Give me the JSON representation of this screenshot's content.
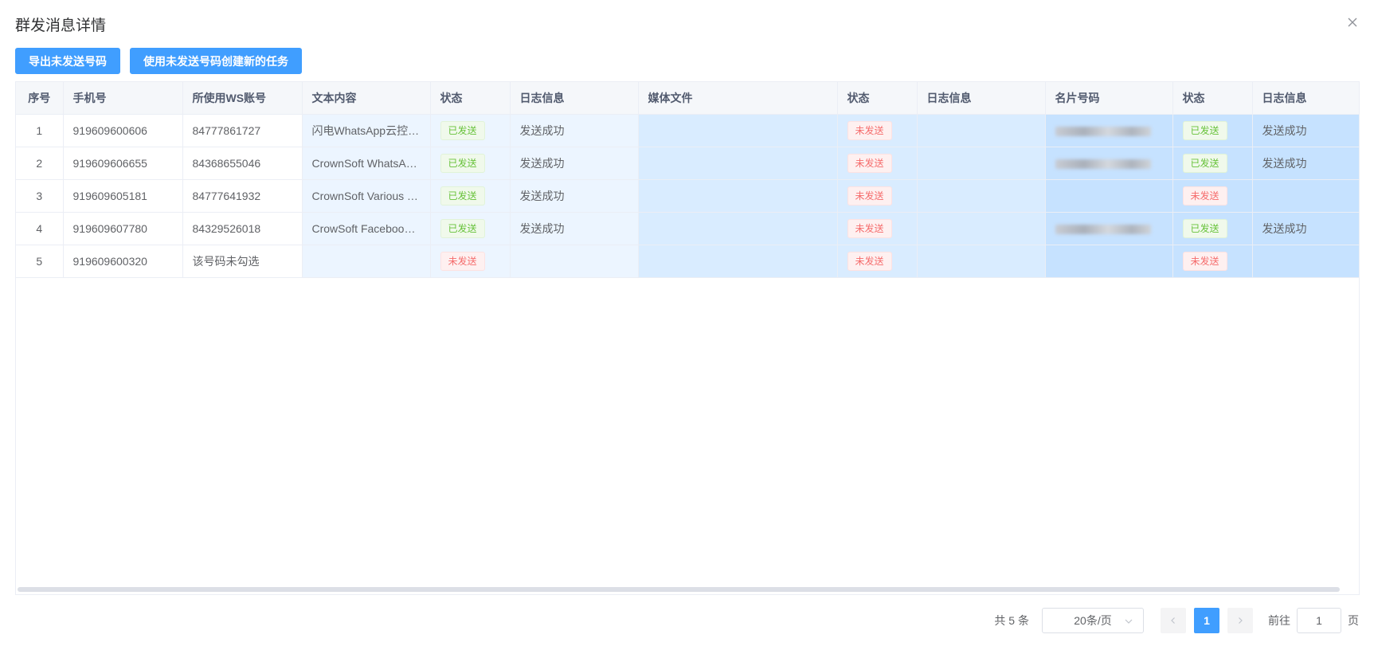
{
  "dialog": {
    "title": "群发消息详情"
  },
  "toolbar": {
    "export_label": "导出未发送号码",
    "create_task_label": "使用未发送号码创建新的任务"
  },
  "table": {
    "headers": [
      "序号",
      "手机号",
      "所使用WS账号",
      "文本内容",
      "状态",
      "日志信息",
      "媒体文件",
      "状态",
      "日志信息",
      "名片号码",
      "状态",
      "日志信息"
    ],
    "rows": [
      {
        "index": "1",
        "phone": "919609600606",
        "ws_account": "84777861727",
        "text": "闪电WhatsApp云控营销系统",
        "text_status": "已发送",
        "text_log": "发送成功",
        "media": "",
        "media_status": "未发送",
        "media_log": "",
        "card": "",
        "card_status": "已发送",
        "card_log": "发送成功"
      },
      {
        "index": "2",
        "phone": "919609606655",
        "ws_account": "84368655046",
        "text": "CrownSoft WhatsApp Marketing",
        "text_status": "已发送",
        "text_log": "发送成功",
        "media": "",
        "media_status": "未发送",
        "media_log": "",
        "card": "",
        "card_status": "已发送",
        "card_log": "发送成功"
      },
      {
        "index": "3",
        "phone": "919609605181",
        "ws_account": "84777641932",
        "text": "CrownSoft Various Tools",
        "text_status": "已发送",
        "text_log": "发送成功",
        "media": "",
        "media_status": "未发送",
        "media_log": "",
        "card": "",
        "card_status": "未发送",
        "card_log": ""
      },
      {
        "index": "4",
        "phone": "919609607780",
        "ws_account": "84329526018",
        "text": "CrowSoft Facebook Marketing",
        "text_status": "已发送",
        "text_log": "发送成功",
        "media": "",
        "media_status": "未发送",
        "media_log": "",
        "card": "",
        "card_status": "已发送",
        "card_log": "发送成功"
      },
      {
        "index": "5",
        "phone": "919609600320",
        "ws_account": "该号码未勾选",
        "text": "",
        "text_status": "未发送",
        "text_log": "",
        "media": "",
        "media_status": "未发送",
        "media_log": "",
        "card": "",
        "card_status": "未发送",
        "card_log": ""
      }
    ]
  },
  "pagination": {
    "total_label": "共 5 条",
    "page_size_label": "20条/页",
    "current_page": "1",
    "goto_label": "前往",
    "goto_value": "1",
    "page_suffix": "页"
  },
  "colors": {
    "primary": "#409eff",
    "sent_tag": "#67c23a",
    "unsent_tag": "#f56c6c"
  },
  "icons": {
    "close": "close-icon",
    "select_chevron": "chevron-down-icon",
    "prev": "chevron-left-icon",
    "next": "chevron-right-icon"
  }
}
